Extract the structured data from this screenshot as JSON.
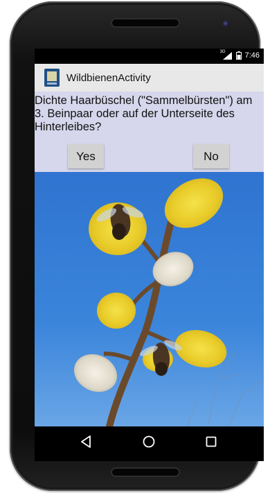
{
  "status_bar": {
    "network": "3G",
    "time": "7:46"
  },
  "action_bar": {
    "title": "WildbienenActivity"
  },
  "question": {
    "text": "Dichte Haarbüschel (\"Sammelbürsten\") am 3. Beinpaar oder auf der Unterseite des Hinterleibes?"
  },
  "buttons": {
    "yes_label": "Yes",
    "no_label": "No"
  },
  "photo": {
    "subject": "bees-on-willow-catkins"
  },
  "nav_bar": {
    "back_icon": "back-triangle-icon",
    "home_icon": "home-circle-icon",
    "recent_icon": "recent-apps-square-icon"
  },
  "colors": {
    "content_background": "#d6d6ec",
    "action_bar": "#e8e8e8",
    "button": "#d2d2d2",
    "sky": "#3a7fd6"
  }
}
